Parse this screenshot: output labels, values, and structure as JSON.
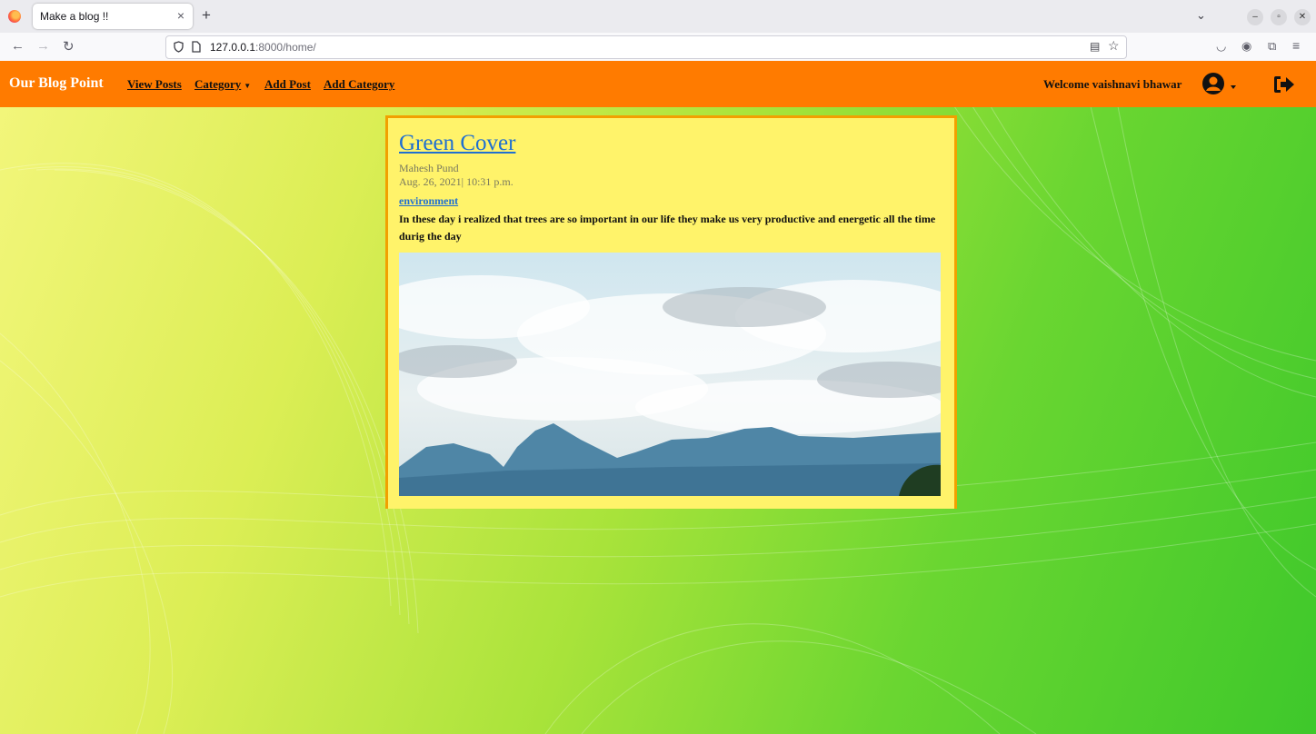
{
  "browser": {
    "tab_title": "Make a blog !!",
    "tab_close": "×",
    "new_tab": "+",
    "url_host": "127.0.0.1",
    "url_rest": ":8000/home/"
  },
  "site": {
    "brand": "Our Blog Point",
    "nav": {
      "view_posts": "View Posts",
      "category": "Category",
      "add_post": "Add Post",
      "add_category": "Add Category"
    },
    "welcome": "Welcome vaishnavi bhawar"
  },
  "post": {
    "title": "Green Cover",
    "author": "Mahesh Pund",
    "date": "Aug. 26, 2021| 10:31 p.m.",
    "category": "environment",
    "body": "In these day i realized that trees are so important in our life they make us very productive and energetic all the time durig the day"
  },
  "colors": {
    "nav_bg": "#ff7b00",
    "card_bg": "#fff36a",
    "card_border": "#f2a000",
    "link": "#1f6fd1"
  },
  "icons": [
    "firefox-logo-icon",
    "back-icon",
    "forward-icon",
    "reload-icon",
    "shield-icon",
    "page-icon",
    "reader-view-icon",
    "bookmark-star-icon",
    "pocket-icon",
    "account-icon",
    "extensions-icon",
    "menu-icon",
    "user-icon",
    "logout-icon"
  ]
}
